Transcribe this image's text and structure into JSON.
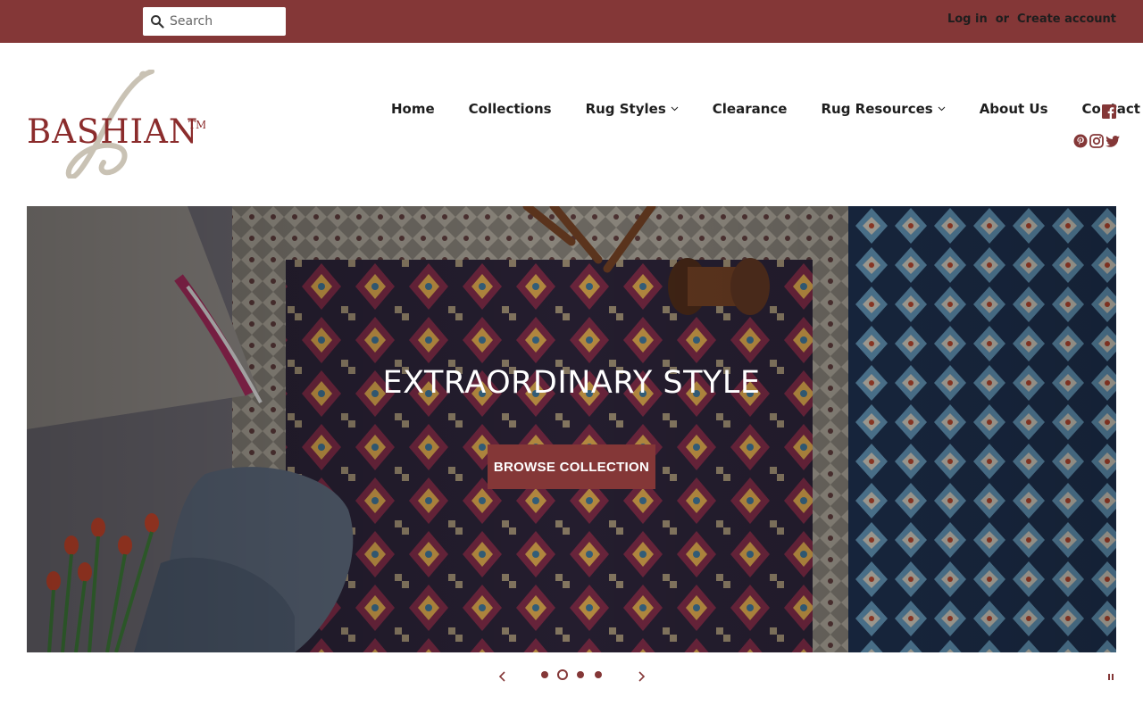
{
  "topbar": {
    "search_placeholder": "Search",
    "login_label": "Log in",
    "or_label": "or",
    "create_account_label": "Create account",
    "background_color": "#843737"
  },
  "logo": {
    "text": "BASHIAN",
    "trademark": "TM",
    "monogram": "B",
    "brand_color": "#8b2c2c",
    "monogram_color": "#c9c2b4"
  },
  "nav": {
    "items": [
      {
        "label": "Home",
        "has_dropdown": false
      },
      {
        "label": "Collections",
        "has_dropdown": false
      },
      {
        "label": "Rug Styles",
        "has_dropdown": true
      },
      {
        "label": "Clearance",
        "has_dropdown": false
      },
      {
        "label": "Rug Resources",
        "has_dropdown": true
      },
      {
        "label": "About Us",
        "has_dropdown": false
      },
      {
        "label": "Contact Us",
        "has_dropdown": true
      }
    ]
  },
  "social": {
    "icons": [
      "facebook-icon",
      "pinterest-icon",
      "instagram-icon",
      "twitter-icon"
    ],
    "color": "#843737"
  },
  "hero": {
    "title": "EXTRAORDINARY STYLE",
    "button_label": "BROWSE COLLECTION",
    "image_description_icon": "rug-photo",
    "slide_count": 4,
    "active_slide": 2
  },
  "slider": {
    "prev_icon": "chevron-left-icon",
    "next_icon": "chevron-right-icon",
    "pause_icon": "pause-icon",
    "accent_color": "#843737"
  }
}
